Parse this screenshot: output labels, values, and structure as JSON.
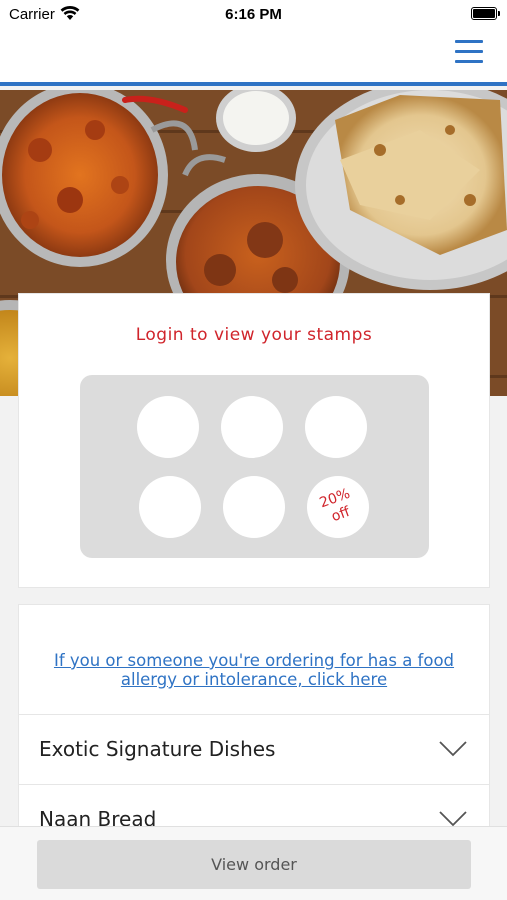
{
  "status_bar": {
    "carrier": "Carrier",
    "time": "6:16 PM",
    "wifi_icon": "wifi-icon",
    "battery_icon": "battery-icon"
  },
  "nav": {
    "menu_icon": "hamburger-menu-icon",
    "accent_color": "#2f73c4"
  },
  "hero": {
    "image": "indian-food-dishes-photo"
  },
  "stamp_card": {
    "title": "Login to view your stamps",
    "stamps_total": 6,
    "stamps_collected": 0,
    "reward_line1": "20%",
    "reward_line2": "off",
    "title_color": "#d0242b"
  },
  "menu": {
    "allergy_link_line1": "If you or someone you're ordering for has a food",
    "allergy_link_line2": "allergy or intolerance, click here",
    "categories": [
      {
        "label": "Exotic Signature Dishes"
      },
      {
        "label": "Naan Bread"
      }
    ]
  },
  "bottom": {
    "view_order_label": "View order"
  }
}
